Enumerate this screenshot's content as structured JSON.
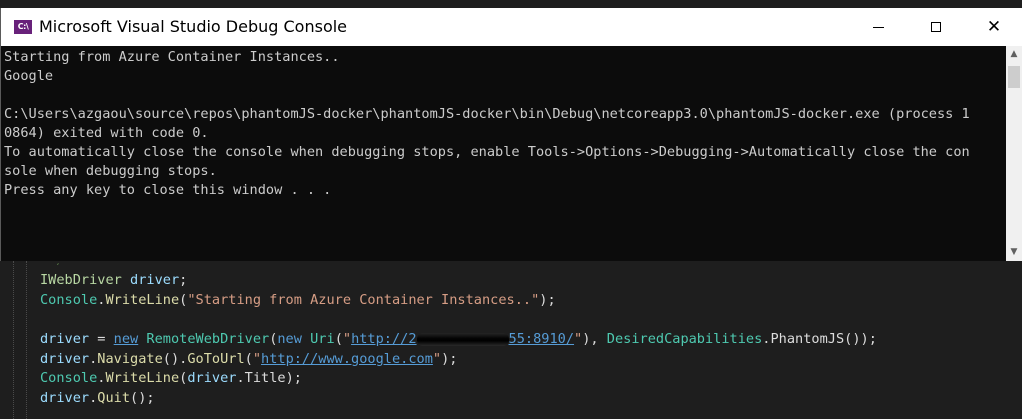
{
  "window": {
    "title": "Microsoft Visual Studio Debug Console",
    "icon_label": "C:\\"
  },
  "console": {
    "lines": [
      "Starting from Azure Container Instances..",
      "Google",
      "",
      "C:\\Users\\azgaou\\source\\repos\\phantomJS-docker\\phantomJS-docker\\bin\\Debug\\netcoreapp3.0\\phantomJS-docker.exe (process 1",
      "0864) exited with code 0.",
      "To automatically close the console when debugging stops, enable Tools->Options->Debugging->Automatically close the con",
      "sole when debugging stops.",
      "Press any key to close this window . . ."
    ]
  },
  "code": {
    "line1": {
      "type": "IWebDriver",
      "var": "driver",
      "end": ";"
    },
    "line2": {
      "cls": "Console",
      "dot": ".",
      "method": "WriteLine",
      "open": "(",
      "str": "\"Starting from Azure Container Instances..\"",
      "close": ");"
    },
    "line4": {
      "var": "driver",
      "eq": " = ",
      "kw_new": "new",
      "space": " ",
      "cls1": "RemoteWebDriver",
      "open1": "(",
      "kw_new2": "new",
      "space2": " ",
      "cls2": "Uri",
      "open2": "(",
      "quote_open": "\"",
      "url_start": "http://2",
      "url_end": "55:8910/",
      "quote_close": "\"",
      "mid": "), ",
      "cls3": "DesiredCapabilities",
      "dot": ".",
      "prop": "PhantomJS",
      "end": "());"
    },
    "line5": {
      "var": "driver",
      "dot1": ".",
      "method1": "Navigate",
      "paren": "()",
      "dot2": ".",
      "method2": "GoToUrl",
      "open": "(",
      "quote_open": "\"",
      "url": "http://www.google.com",
      "quote_close": "\"",
      "end": ");"
    },
    "line6": {
      "cls": "Console",
      "dot1": ".",
      "method": "WriteLine",
      "open": "(",
      "var": "driver",
      "dot2": ".",
      "prop": "Title",
      "end": ");"
    },
    "line7": {
      "var": "driver",
      "dot": ".",
      "method": "Quit",
      "end": "();"
    }
  }
}
